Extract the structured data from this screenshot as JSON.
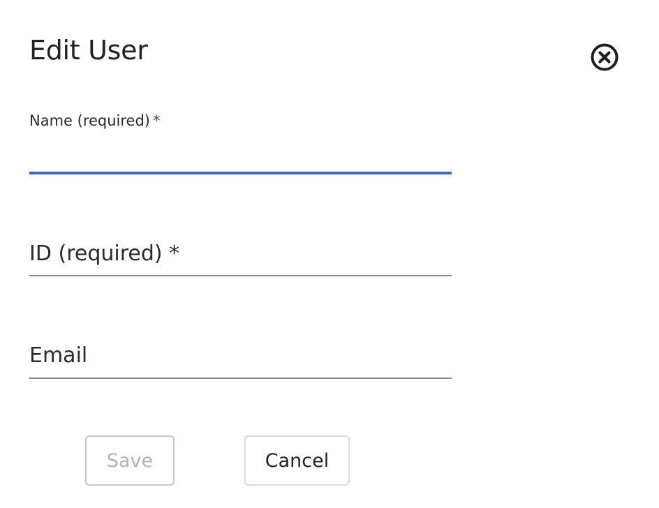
{
  "dialog": {
    "title": "Edit User",
    "close_icon": "close-circle-icon"
  },
  "fields": {
    "name": {
      "label": "Name (required)",
      "required_marker": "*",
      "value": "",
      "state": "focused"
    },
    "id": {
      "label": "ID (required) *",
      "value": ""
    },
    "email": {
      "label": "Email",
      "value": ""
    }
  },
  "actions": {
    "save_label": "Save",
    "save_state": "disabled",
    "cancel_label": "Cancel"
  },
  "colors": {
    "focus_underline": "#3f6ab8",
    "required_star": "#1f4e96",
    "idle_underline": "#8a8a8a",
    "disabled_text": "#b3b3b3"
  }
}
